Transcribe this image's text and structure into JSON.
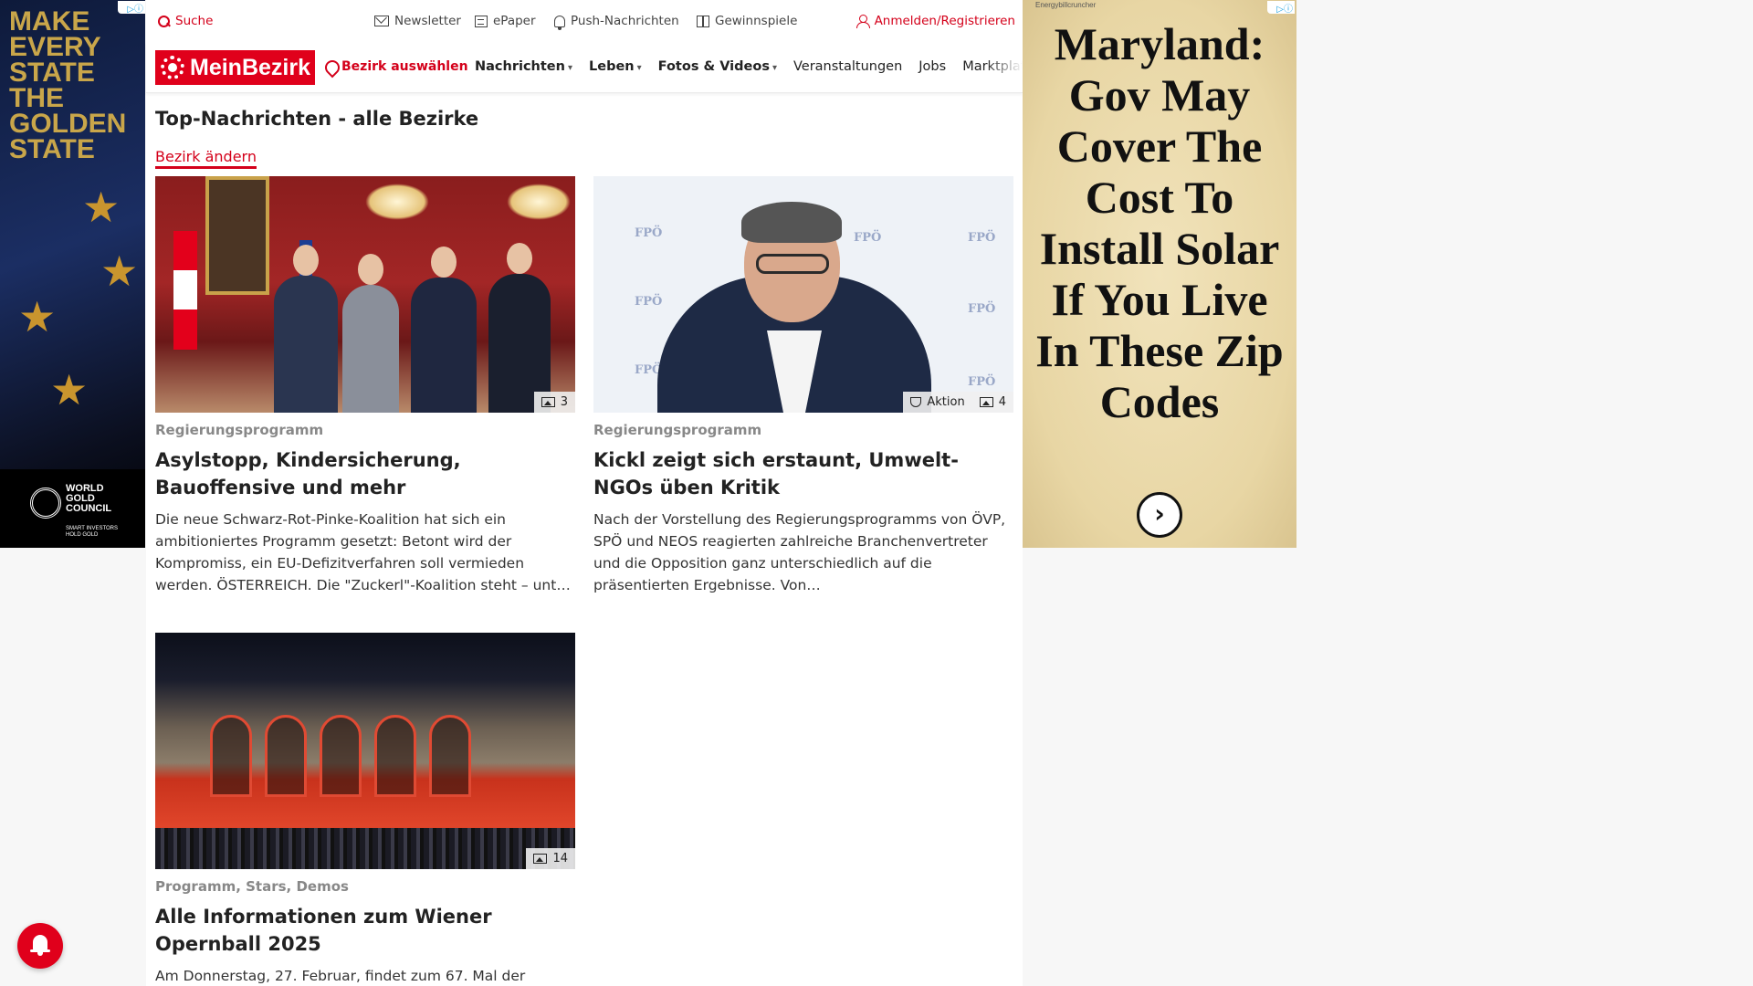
{
  "left_ad": {
    "headline": "MAKE\nEVERY\nSTATE\nTHE\nGOLDEN\nSTATE",
    "brand": "WORLD\nGOLD\nCOUNCIL",
    "tagline": "SMART INVESTORS\nHOLD GOLD",
    "adchoices": "▷ⓘ"
  },
  "topbar": {
    "search": "Suche",
    "newsletter": "Newsletter",
    "epaper": "ePaper",
    "push": "Push-Nachrichten",
    "gewinnspiele": "Gewinnspiele",
    "login": "Anmelden/Registrieren"
  },
  "nav": {
    "logo": "MeinBezirk",
    "bezirk": "Bezirk auswählen",
    "items": [
      "Nachrichten",
      "Leben",
      "Fotos & Videos",
      "Veranstaltungen",
      "Jobs",
      "Marktplatz"
    ]
  },
  "page": {
    "title": "Top-Nachrichten - alle Bezirke",
    "change_link": "Bezirk ändern"
  },
  "articles": [
    {
      "kicker": "Regierungsprogramm",
      "headline": "Asylstopp, Kindersicherung, Bauoffensive und mehr",
      "teaser": "Die neue Schwarz-Rot-Pinke-Koalition hat sich ein ambitioniertes Programm gesetzt: Betont wird der Kompromiss, ein EU-Defizitverfahren soll vermieden werden.  ÖSTERREICH. Die \"Zuckerl\"-Koalition steht – unter …",
      "photo_count": "3"
    },
    {
      "kicker": "Regierungsprogramm",
      "headline": "Kickl zeigt sich erstaunt, Umwelt-NGOs üben Kritik",
      "teaser": "Nach der Vorstellung des Regierungsprogramms von ÖVP, SPÖ und NEOS reagierten zahlreiche Branchenvertreter und die Opposition ganz unterschiedlich auf die präsentierten Ergebnisse. Von…",
      "action_label": "Aktion",
      "photo_count": "4",
      "watermark": "FPÖ"
    },
    {
      "kicker": "Programm, Stars, Demos",
      "headline": "Alle Informationen zum Wiener Opernball 2025",
      "teaser": "Am Donnerstag, 27. Februar, findet zum 67. Mal der",
      "photo_count": "14"
    }
  ],
  "right_ad": {
    "sponsor": "Energybillcruncher",
    "headline": "Maryland: Gov May Cover The Cost To Install Solar If You Live In These Zip Codes",
    "adchoices": "▷ⓘ",
    "arrow": "›"
  },
  "colors": {
    "brand_red": "#e0001b",
    "link_red": "#d4001a",
    "ad_gold": "#c9a64a"
  }
}
